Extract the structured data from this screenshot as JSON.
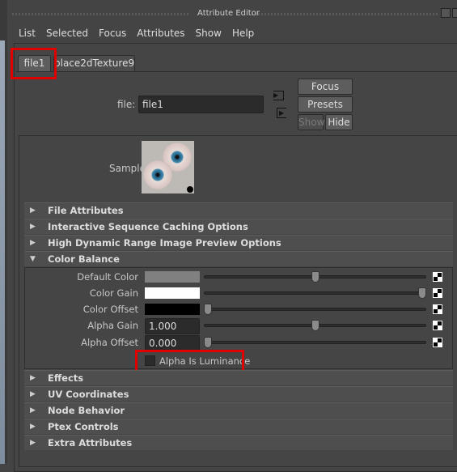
{
  "window": {
    "title": "Attribute Editor"
  },
  "menu": [
    "List",
    "Selected",
    "Focus",
    "Attributes",
    "Show",
    "Help"
  ],
  "tabs": [
    {
      "label": "file1",
      "active": true
    },
    {
      "label": "place2dTexture9",
      "active": false
    }
  ],
  "node": {
    "file_label": "file:",
    "file_value": "file1"
  },
  "buttons": {
    "focus": "Focus",
    "presets": "Presets",
    "show": "Show",
    "hide": "Hide"
  },
  "sample": {
    "label": "Sample",
    "icon": "eyeball-texture-thumbnail"
  },
  "sections_top": [
    {
      "label": "File Attributes",
      "expanded": false
    },
    {
      "label": "Interactive Sequence Caching Options",
      "expanded": false
    },
    {
      "label": "High Dynamic Range Image Preview Options",
      "expanded": false
    },
    {
      "label": "Color Balance",
      "expanded": true
    }
  ],
  "color_balance": {
    "rows": [
      {
        "label": "Default Color",
        "type": "color",
        "color": "#808080",
        "slider": 0.5
      },
      {
        "label": "Color Gain",
        "type": "color",
        "color": "#ffffff",
        "slider": 1.0
      },
      {
        "label": "Color Offset",
        "type": "color",
        "color": "#000000",
        "slider": 0.0
      },
      {
        "label": "Alpha Gain",
        "type": "number",
        "value": "1.000",
        "slider": 0.5
      },
      {
        "label": "Alpha Offset",
        "type": "number",
        "value": "0.000",
        "slider": 0.0
      }
    ],
    "alpha_is_luminance": {
      "label": "Alpha Is Luminance",
      "checked": false
    }
  },
  "sections_bottom": [
    {
      "label": "Effects"
    },
    {
      "label": "UV Coordinates"
    },
    {
      "label": "Node Behavior"
    },
    {
      "label": "Ptex Controls"
    },
    {
      "label": "Extra Attributes"
    }
  ],
  "colors": {
    "highlight": "#e00000",
    "panel": "#444444"
  }
}
